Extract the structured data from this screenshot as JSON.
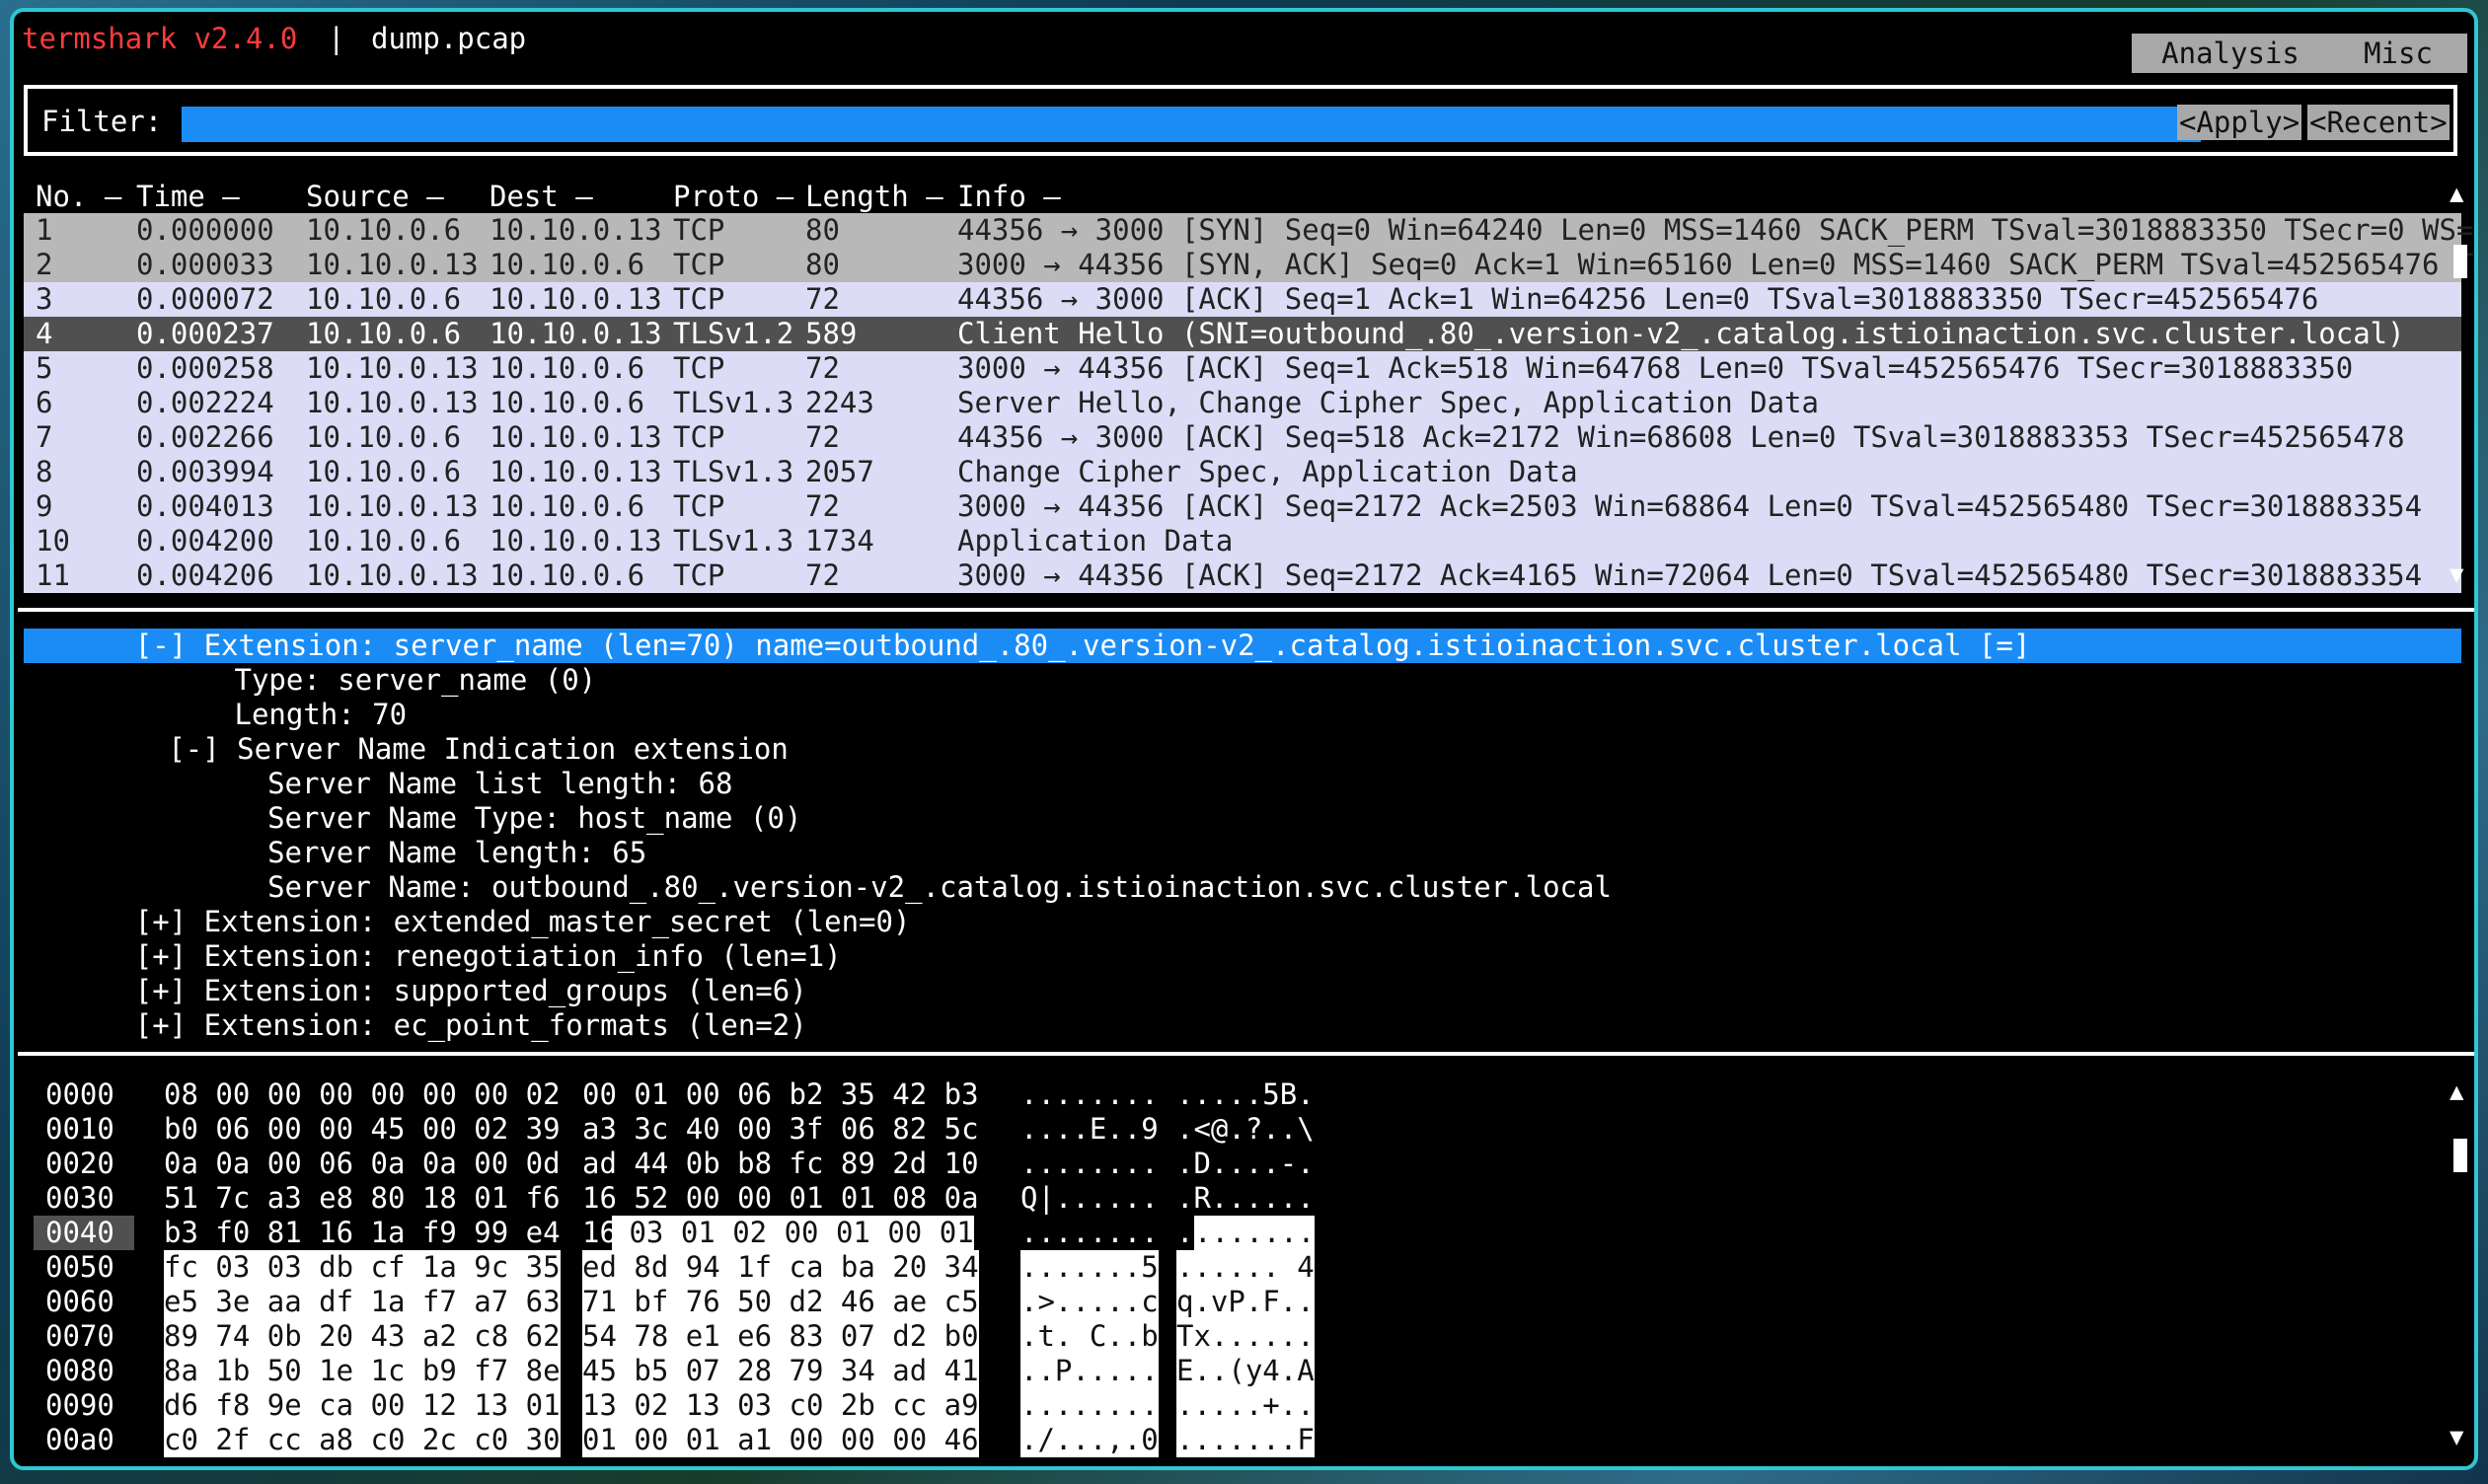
{
  "title": {
    "app": "termshark v2.4.0",
    "sep": "|",
    "file": "dump.pcap"
  },
  "menu": {
    "analysis": "Analysis",
    "misc": "Misc"
  },
  "filter": {
    "label": "Filter:",
    "value": "",
    "apply": "<Apply>",
    "recent": "<Recent>"
  },
  "packet_columns": [
    "No. –",
    "Time –",
    "Source –",
    "Dest –",
    "Proto –",
    "Length –",
    "Info –"
  ],
  "packets": [
    {
      "no": "1",
      "time": "0.000000",
      "src": "10.10.0.6",
      "dst": "10.10.0.13",
      "proto": "TCP",
      "len": "80",
      "info": "44356 → 3000 [SYN] Seq=0 Win=64240 Len=0 MSS=1460 SACK_PERM TSval=3018883350 TSecr=0 WS=",
      "style": "gray"
    },
    {
      "no": "2",
      "time": "0.000033",
      "src": "10.10.0.13",
      "dst": "10.10.0.6",
      "proto": "TCP",
      "len": "80",
      "info": "3000 → 44356 [SYN, ACK] Seq=0 Ack=1 Win=65160 Len=0 MSS=1460 SACK_PERM TSval=452565476 T",
      "style": "gray"
    },
    {
      "no": "3",
      "time": "0.000072",
      "src": "10.10.0.6",
      "dst": "10.10.0.13",
      "proto": "TCP",
      "len": "72",
      "info": "44356 → 3000 [ACK] Seq=1 Ack=1 Win=64256 Len=0 TSval=3018883350 TSecr=452565476",
      "style": "lav"
    },
    {
      "no": "4",
      "time": "0.000237",
      "src": "10.10.0.6",
      "dst": "10.10.0.13",
      "proto": "TLSv1.2",
      "len": "589",
      "info": "Client Hello (SNI=outbound_.80_.version-v2_.catalog.istioinaction.svc.cluster.local)",
      "style": "sel"
    },
    {
      "no": "5",
      "time": "0.000258",
      "src": "10.10.0.13",
      "dst": "10.10.0.6",
      "proto": "TCP",
      "len": "72",
      "info": "3000 → 44356 [ACK] Seq=1 Ack=518 Win=64768 Len=0 TSval=452565476 TSecr=3018883350",
      "style": "lav"
    },
    {
      "no": "6",
      "time": "0.002224",
      "src": "10.10.0.13",
      "dst": "10.10.0.6",
      "proto": "TLSv1.3",
      "len": "2243",
      "info": "Server Hello, Change Cipher Spec, Application Data",
      "style": "lav"
    },
    {
      "no": "7",
      "time": "0.002266",
      "src": "10.10.0.6",
      "dst": "10.10.0.13",
      "proto": "TCP",
      "len": "72",
      "info": "44356 → 3000 [ACK] Seq=518 Ack=2172 Win=68608 Len=0 TSval=3018883353 TSecr=452565478",
      "style": "lav"
    },
    {
      "no": "8",
      "time": "0.003994",
      "src": "10.10.0.6",
      "dst": "10.10.0.13",
      "proto": "TLSv1.3",
      "len": "2057",
      "info": "Change Cipher Spec, Application Data",
      "style": "lav"
    },
    {
      "no": "9",
      "time": "0.004013",
      "src": "10.10.0.13",
      "dst": "10.10.0.6",
      "proto": "TCP",
      "len": "72",
      "info": "3000 → 44356 [ACK] Seq=2172 Ack=2503 Win=68864 Len=0 TSval=452565480 TSecr=3018883354",
      "style": "lav"
    },
    {
      "no": "10",
      "time": "0.004200",
      "src": "10.10.0.6",
      "dst": "10.10.0.13",
      "proto": "TLSv1.3",
      "len": "1734",
      "info": "Application Data",
      "style": "lav"
    },
    {
      "no": "11",
      "time": "0.004206",
      "src": "10.10.0.13",
      "dst": "10.10.0.6",
      "proto": "TCP",
      "len": "72",
      "info": "3000 → 44356 [ACK] Seq=2172 Ack=4165 Win=72064 Len=0 TSval=452565480 TSecr=3018883354",
      "style": "lav"
    }
  ],
  "details": [
    {
      "text": "[-] Extension: server_name (len=70) name=outbound_.80_.version-v2_.catalog.istioinaction.svc.cluster.local [=]",
      "indent": 3,
      "hl": true
    },
    {
      "text": "Type: server_name (0)",
      "indent": 6,
      "hl": false
    },
    {
      "text": "Length: 70",
      "indent": 6,
      "hl": false
    },
    {
      "text": "[-] Server Name Indication extension",
      "indent": 4,
      "hl": false
    },
    {
      "text": "Server Name list length: 68",
      "indent": 7,
      "hl": false
    },
    {
      "text": "Server Name Type: host_name (0)",
      "indent": 7,
      "hl": false
    },
    {
      "text": "Server Name length: 65",
      "indent": 7,
      "hl": false
    },
    {
      "text": "Server Name: outbound_.80_.version-v2_.catalog.istioinaction.svc.cluster.local",
      "indent": 7,
      "hl": false
    },
    {
      "text": "[+] Extension: extended_master_secret (len=0)",
      "indent": 3,
      "hl": false
    },
    {
      "text": "[+] Extension: renegotiation_info (len=1)",
      "indent": 3,
      "hl": false
    },
    {
      "text": "[+] Extension: supported_groups (len=6)",
      "indent": 3,
      "hl": false
    },
    {
      "text": "[+] Extension: ec_point_formats (len=2)",
      "indent": 3,
      "hl": false
    }
  ],
  "hex": [
    {
      "off": "0000",
      "a": "08 00 00 00 00 00 00 02",
      "b": "00 01 00 06 b2 35 42 b3",
      "asc_a": "........",
      "asc_b": ".....5B.",
      "mode": "none"
    },
    {
      "off": "0010",
      "a": "b0 06 00 00 45 00 02 39",
      "b": "a3 3c 40 00 3f 06 82 5c",
      "asc_a": "....E..9",
      "asc_b": ".<@.?..\\",
      "mode": "none"
    },
    {
      "off": "0020",
      "a": "0a 0a 00 06 0a 0a 00 0d",
      "b": "ad 44 0b b8 fc 89 2d 10",
      "asc_a": "........",
      "asc_b": ".D....-.",
      "mode": "none"
    },
    {
      "off": "0030",
      "a": "51 7c a3 e8 80 18 01 f6",
      "b": "16 52 00 00 01 01 08 0a",
      "asc_a": "Q|......",
      "asc_b": ".R......",
      "mode": "none"
    },
    {
      "off": "0040",
      "a": "b3 f0 81 16 1a f9 99 e4",
      "b": "16",
      "b_rest": "03 01 02 00 01 00 01",
      "asc_a": "........",
      "asc_b": ".",
      "asc_b_rest": ".......",
      "mode": "partial"
    },
    {
      "off": "0050",
      "a": "fc 03 03 db cf 1a 9c 35",
      "b": "ed 8d 94 1f ca ba 20 34",
      "asc_a": ".......5",
      "asc_b": "...... 4",
      "mode": "full"
    },
    {
      "off": "0060",
      "a": "e5 3e aa df 1a f7 a7 63",
      "b": "71 bf 76 50 d2 46 ae c5",
      "asc_a": ".>.....c",
      "asc_b": "q.vP.F..",
      "mode": "full"
    },
    {
      "off": "0070",
      "a": "89 74 0b 20 43 a2 c8 62",
      "b": "54 78 e1 e6 83 07 d2 b0",
      "asc_a": ".t. C..b",
      "asc_b": "Tx......",
      "mode": "full"
    },
    {
      "off": "0080",
      "a": "8a 1b 50 1e 1c b9 f7 8e",
      "b": "45 b5 07 28 79 34 ad 41",
      "asc_a": "..P.....",
      "asc_b": "E..(y4.A",
      "mode": "full"
    },
    {
      "off": "0090",
      "a": "d6 f8 9e ca 00 12 13 01",
      "b": "13 02 13 03 c0 2b cc a9",
      "asc_a": "........",
      "asc_b": ".....+..",
      "mode": "full"
    },
    {
      "off": "00a0",
      "a": "c0 2f cc a8 c0 2c c0 30",
      "b": "01 00 01 a1 00 00 00 46",
      "asc_a": "./...,.0",
      "asc_b": ".......F",
      "mode": "full"
    }
  ],
  "hex_selected_offset": "0040"
}
